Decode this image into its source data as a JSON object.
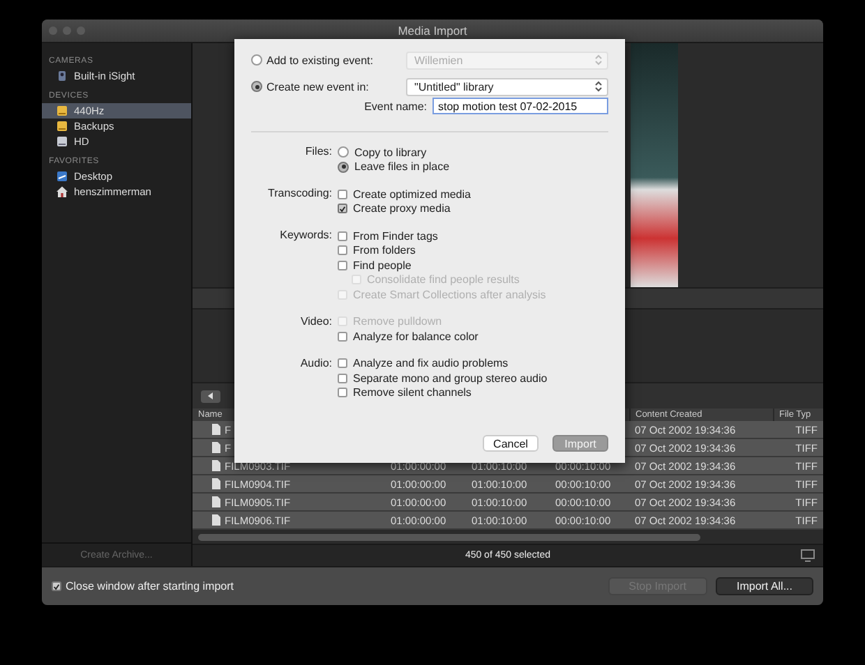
{
  "window": {
    "title": "Media Import"
  },
  "sidebar": {
    "sections": [
      {
        "title": "CAMERAS",
        "items": [
          {
            "label": "Built-in iSight",
            "kind": "camera",
            "selected": false
          }
        ]
      },
      {
        "title": "DEVICES",
        "items": [
          {
            "label": "440Hz",
            "kind": "external-drive",
            "selected": true
          },
          {
            "label": "Backups",
            "kind": "external-drive",
            "selected": false
          },
          {
            "label": "HD",
            "kind": "hard-drive",
            "selected": false
          }
        ]
      },
      {
        "title": "FAVORITES",
        "items": [
          {
            "label": "Desktop",
            "kind": "desktop",
            "selected": false
          },
          {
            "label": "henszimmerman",
            "kind": "home",
            "selected": false
          }
        ]
      }
    ],
    "footer_button": {
      "label": "Create Archive...",
      "disabled": true
    }
  },
  "table": {
    "columns": [
      "Name",
      "",
      "",
      "",
      "Content Created",
      "File Typ"
    ],
    "rows": [
      {
        "selected": true,
        "cells": [
          "F",
          "",
          "",
          "",
          "07 Oct 2002 19:34:36",
          "TIFF"
        ]
      },
      {
        "selected": true,
        "cells": [
          "F",
          "",
          "",
          "",
          "07 Oct 2002 19:34:36",
          "TIFF"
        ]
      },
      {
        "selected": true,
        "cells": [
          "FILM0903.TIF",
          "01:00:00:00",
          "01:00:10:00",
          "00:00:10:00",
          "07 Oct 2002 19:34:36",
          "TIFF"
        ]
      },
      {
        "selected": true,
        "cells": [
          "FILM0904.TIF",
          "01:00:00:00",
          "01:00:10:00",
          "00:00:10:00",
          "07 Oct 2002 19:34:36",
          "TIFF"
        ]
      },
      {
        "selected": true,
        "cells": [
          "FILM0905.TIF",
          "01:00:00:00",
          "01:00:10:00",
          "00:00:10:00",
          "07 Oct 2002 19:34:36",
          "TIFF"
        ]
      },
      {
        "selected": true,
        "cells": [
          "FILM0906.TIF",
          "01:00:00:00",
          "01:00:10:00",
          "00:00:10:00",
          "07 Oct 2002 19:34:36",
          "TIFF"
        ]
      }
    ]
  },
  "status": "450 of 450 selected",
  "bottom_bar": {
    "close_after": {
      "label": "Close window after starting import",
      "checked": true
    },
    "buttons": [
      {
        "label": "Stop Import",
        "disabled": true
      },
      {
        "label": "Import All...",
        "disabled": false
      }
    ]
  },
  "dialog": {
    "existing_event": {
      "label": "Add to existing event:",
      "selected": false,
      "value": "Willemien",
      "disabled": true
    },
    "new_event": {
      "label": "Create new event in:",
      "selected": true,
      "value": "\"Untitled\" library",
      "disabled": false
    },
    "event_name": {
      "label": "Event name:",
      "value": "stop motion test 07-02-2015"
    },
    "groups": [
      {
        "label": "Files:",
        "options": [
          {
            "kind": "radio",
            "label": "Copy to library",
            "selected": false,
            "disabled": false
          },
          {
            "kind": "radio",
            "label": "Leave files in place",
            "selected": true,
            "disabled": false
          }
        ]
      },
      {
        "label": "Transcoding:",
        "options": [
          {
            "kind": "checkbox",
            "label": "Create optimized media",
            "checked": false,
            "disabled": false
          },
          {
            "kind": "checkbox",
            "label": "Create proxy media",
            "checked": true,
            "disabled": false
          }
        ]
      },
      {
        "label": "Keywords:",
        "options": [
          {
            "kind": "checkbox",
            "label": "From Finder tags",
            "checked": false,
            "disabled": false
          },
          {
            "kind": "checkbox",
            "label": "From folders",
            "checked": false,
            "disabled": false
          },
          {
            "kind": "checkbox",
            "label": "Find people",
            "checked": false,
            "disabled": false,
            "children": [
              {
                "kind": "checkbox",
                "label": "Consolidate find people results",
                "checked": false,
                "disabled": true
              }
            ]
          },
          {
            "kind": "checkbox",
            "label": "Create Smart Collections after analysis",
            "checked": false,
            "disabled": true
          }
        ]
      },
      {
        "label": "Video:",
        "options": [
          {
            "kind": "checkbox",
            "label": "Remove pulldown",
            "checked": false,
            "disabled": true
          },
          {
            "kind": "checkbox",
            "label": "Analyze for balance color",
            "checked": false,
            "disabled": false
          }
        ]
      },
      {
        "label": "Audio:",
        "options": [
          {
            "kind": "checkbox",
            "label": "Analyze and fix audio problems",
            "checked": false,
            "disabled": false
          },
          {
            "kind": "checkbox",
            "label": "Separate mono and group stereo audio",
            "checked": false,
            "disabled": false
          },
          {
            "kind": "checkbox",
            "label": "Remove silent channels",
            "checked": false,
            "disabled": false
          }
        ]
      }
    ],
    "buttons": [
      {
        "label": "Cancel",
        "disabled": false
      },
      {
        "label": "Import",
        "disabled": true
      }
    ]
  }
}
